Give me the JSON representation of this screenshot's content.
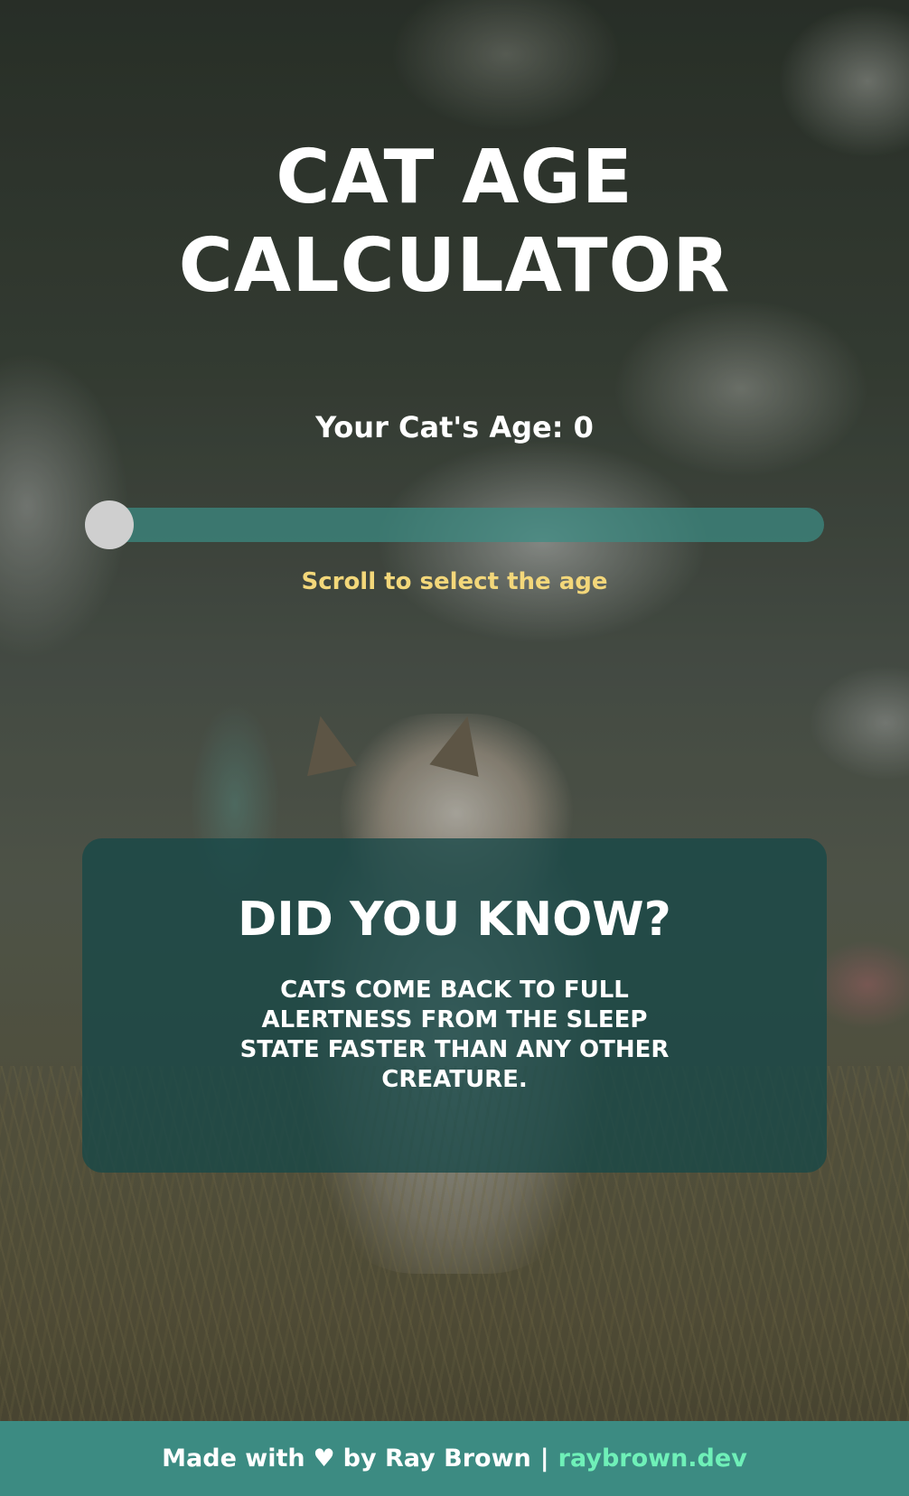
{
  "header": {
    "title_line1": "CAT AGE",
    "title_line2": "CALCULATOR"
  },
  "age": {
    "label": "Your Cat's Age: 0",
    "slider_value": 0,
    "hint": "Scroll to select the age"
  },
  "fact": {
    "title": "DID YOU KNOW?",
    "text": "CATS COME BACK TO FULL ALERTNESS FROM THE SLEEP STATE FASTER THAN ANY OTHER CREATURE."
  },
  "footer": {
    "made_with": "Made with",
    "heart": "♥",
    "by": "by Ray Brown",
    "separator": "|",
    "link": "raybrown.dev"
  },
  "colors": {
    "accent": "#3c8b82",
    "hint": "#f3d77a",
    "link": "#6ff0b8",
    "card": "#174848"
  },
  "icons": {
    "heart": "heart-icon"
  }
}
